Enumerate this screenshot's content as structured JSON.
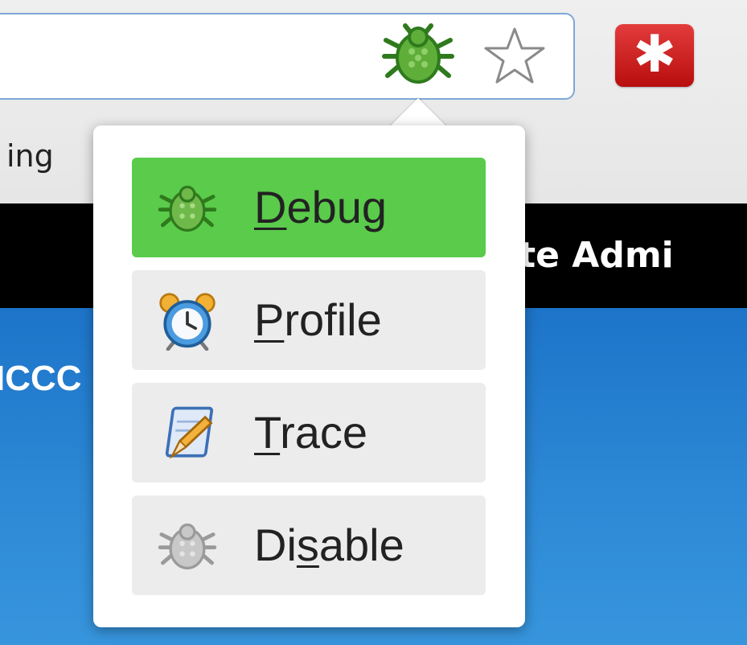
{
  "browser": {
    "bookmark_partial": "ing",
    "extension_icon": "bug-icon",
    "star_icon": "star-icon",
    "lastpass_icon": "lastpass-icon",
    "lastpass_glyph": "✱"
  },
  "page": {
    "site_bar_text": "ite Admi",
    "content_partial_text": "ICCC"
  },
  "menu": {
    "items": [
      {
        "pre": "",
        "u": "D",
        "post": "ebug",
        "icon": "bug-icon",
        "active": true
      },
      {
        "pre": "",
        "u": "P",
        "post": "rofile",
        "icon": "alarm-clock-icon",
        "active": false
      },
      {
        "pre": "",
        "u": "T",
        "post": "race",
        "icon": "notepad-pencil-icon",
        "active": false
      },
      {
        "pre": "Di",
        "u": "s",
        "post": "able",
        "icon": "disabled-bug-icon",
        "active": false
      }
    ]
  },
  "colors": {
    "active_item": "#5acb4b",
    "item_bg": "#ececec",
    "site_bar": "#000000",
    "content_blue": "#2e8ad6",
    "omnibox_border": "#7ea7d8",
    "lastpass_red": "#d32a2a"
  }
}
